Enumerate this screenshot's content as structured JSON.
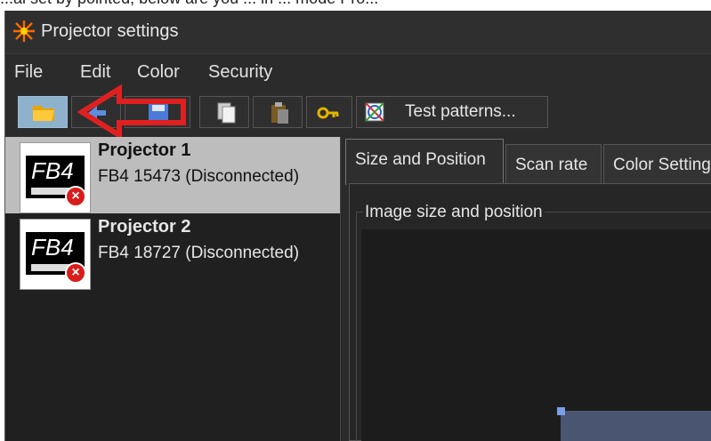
{
  "page_caption": "...al set by pointed, below are you ... in ... mode Pro...",
  "window": {
    "title": "Projector settings"
  },
  "menu": [
    "File",
    "Edit",
    "Color",
    "Security"
  ],
  "toolbar": {
    "test_patterns_label": "Test patterns..."
  },
  "projectors": [
    {
      "name": "Projector 1",
      "status": "FB4 15473 (Disconnected)",
      "selected": true,
      "thumb_text": "FB4"
    },
    {
      "name": "Projector 2",
      "status": "FB4 18727 (Disconnected)",
      "selected": false,
      "thumb_text": "FB4"
    }
  ],
  "tabs": [
    "Size and Position",
    "Scan rate",
    "Color Settings"
  ],
  "active_tab": "Size and Position",
  "group": {
    "title": "Image size and position"
  },
  "colors": {
    "annotation_arrow": "#e02020",
    "selected_item": "#bdbdbd",
    "image_rect": "#4a5572"
  }
}
